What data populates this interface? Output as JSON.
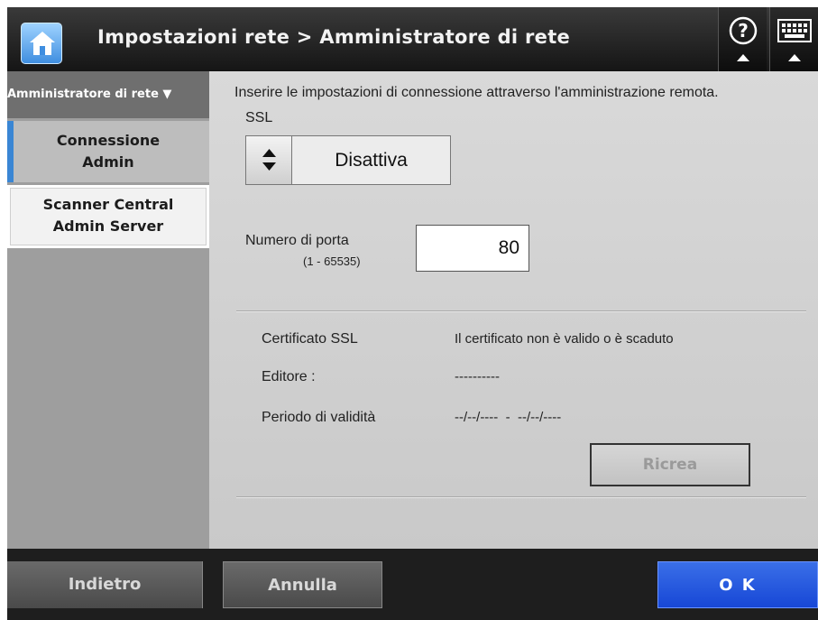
{
  "header": {
    "title": "Impostazioni rete > Amministratore di rete",
    "home_icon": "home-icon",
    "help_icon": "help-icon",
    "keyboard_icon": "keyboard-icon"
  },
  "sidebar": {
    "heading": "Amministratore di rete ▼",
    "items": [
      {
        "line1": "Connessione",
        "line2": "Admin"
      },
      {
        "line1": "Scanner Central",
        "line2": "Admin Server"
      }
    ]
  },
  "main": {
    "intro": "Inserire le impostazioni di connessione attraverso l'amministrazione remota.",
    "ssl_label": "SSL",
    "ssl_value": "Disattiva",
    "port_label": "Numero di porta",
    "port_range": "(1 - 65535)",
    "port_value": "80",
    "certificate": {
      "label": "Certificato SSL",
      "status": "Il certificato non è valido o è scaduto",
      "issuer_label": "Editore :",
      "issuer_value": "----------",
      "validity_label": "Periodo di validità",
      "validity_value": "--/--/----  -  --/--/----"
    },
    "recreate_button": "Ricrea"
  },
  "footer": {
    "back": "Indietro",
    "cancel": "Annulla",
    "ok": "O K"
  },
  "colors": {
    "accent_blue": "#1747d6",
    "sidebar_active_bar": "#3a86d4",
    "home_button": "#3f8ee0"
  }
}
